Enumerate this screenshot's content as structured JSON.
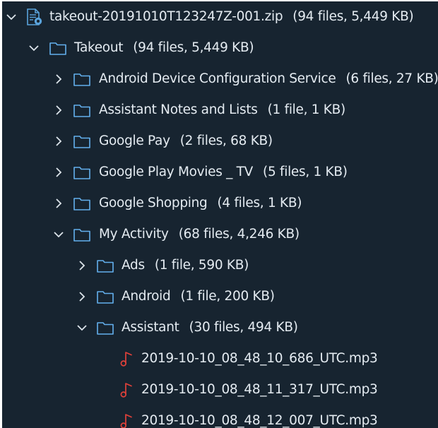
{
  "colors": {
    "background": "#172430",
    "text": "#e4ebf1",
    "chevron": "#dce4ea",
    "folder_outline": "#63b0ee",
    "zip_icon": "#5aa3dc",
    "audio_icon": "#e0413a"
  },
  "tree": {
    "root": {
      "name": "takeout-20191010T123247Z-001.zip",
      "meta": "(94 files, 5,449 KB)",
      "icon": "zip-archive-icon",
      "expanded": true
    },
    "takeout": {
      "name": "Takeout",
      "meta": "(94 files, 5,449 KB)",
      "icon": "folder-icon",
      "expanded": true
    },
    "children": [
      {
        "name": "Android Device Configuration Service",
        "meta": "(6 files, 27 KB)",
        "icon": "folder-icon",
        "expanded": false
      },
      {
        "name": "Assistant Notes and Lists",
        "meta": "(1 file, 1 KB)",
        "icon": "folder-icon",
        "expanded": false
      },
      {
        "name": "Google Pay",
        "meta": "(2 files, 68 KB)",
        "icon": "folder-icon",
        "expanded": false
      },
      {
        "name": "Google Play Movies _ TV",
        "meta": "(5 files, 1 KB)",
        "icon": "folder-icon",
        "expanded": false
      },
      {
        "name": "Google Shopping",
        "meta": "(4 files, 1 KB)",
        "icon": "folder-icon",
        "expanded": false
      },
      {
        "name": "My Activity",
        "meta": "(68 files, 4,246 KB)",
        "icon": "folder-icon",
        "expanded": true
      }
    ],
    "my_activity_children": [
      {
        "name": "Ads",
        "meta": "(1 file, 590 KB)",
        "icon": "folder-icon",
        "expanded": false
      },
      {
        "name": "Android",
        "meta": "(1 file, 200 KB)",
        "icon": "folder-icon",
        "expanded": false
      },
      {
        "name": "Assistant",
        "meta": "(30 files, 494 KB)",
        "icon": "folder-icon",
        "expanded": true
      }
    ],
    "assistant_files": [
      {
        "name": "2019-10-10_08_48_10_686_UTC.mp3",
        "icon": "audio-file-icon"
      },
      {
        "name": "2019-10-10_08_48_11_317_UTC.mp3",
        "icon": "audio-file-icon"
      },
      {
        "name": "2019-10-10_08_48_12_007_UTC.mp3",
        "icon": "audio-file-icon"
      }
    ]
  }
}
